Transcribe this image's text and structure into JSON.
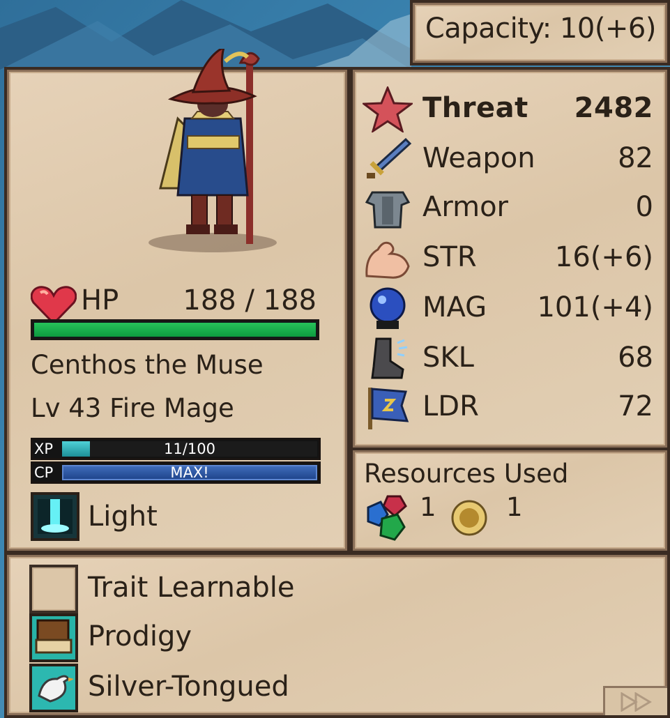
{
  "capacity": {
    "text": "Capacity: 10(+6)"
  },
  "unit": {
    "hp_label": "HP",
    "hp_value": "188 / 188",
    "hp_fraction": 1.0,
    "name": "Centhos the Muse",
    "level_class": "Lv 43 Fire Mage",
    "xp": {
      "tag": "XP",
      "value": "11/100",
      "fraction": 0.11
    },
    "cp": {
      "tag": "CP",
      "value": "MAX!",
      "fraction": 1.0
    },
    "element": {
      "icon": "light-element-icon",
      "label": "Light"
    }
  },
  "stats": [
    {
      "icon": "star-icon",
      "label": "Threat",
      "value": "2482"
    },
    {
      "icon": "sword-icon",
      "label": "Weapon",
      "value": "82"
    },
    {
      "icon": "armor-icon",
      "label": "Armor",
      "value": "0"
    },
    {
      "icon": "muscle-arm-icon",
      "label": "STR",
      "value": "16(+6)"
    },
    {
      "icon": "crystal-ball-icon",
      "label": "MAG",
      "value": "101(+4)"
    },
    {
      "icon": "boot-icon",
      "label": "SKL",
      "value": "68"
    },
    {
      "icon": "banner-flag-icon",
      "label": "LDR",
      "value": "72"
    }
  ],
  "resources": {
    "title": "Resources Used",
    "items": [
      {
        "icon": "gems-icon",
        "count": "1"
      },
      {
        "icon": "gold-coin-icon",
        "count": "1"
      }
    ]
  },
  "traits": [
    {
      "icon": "empty-slot-icon",
      "label": "Trait Learnable"
    },
    {
      "icon": "scroll-book-icon",
      "label": "Prodigy"
    },
    {
      "icon": "white-bird-icon",
      "label": "Silver-Tongued"
    }
  ],
  "colors": {
    "hp_bar": "#0d9a3f",
    "xp_bar": "#2fa9b0",
    "cp_bar": "#2f56a3",
    "panel": "#dcc6a8",
    "frame": "#3a2b22"
  }
}
